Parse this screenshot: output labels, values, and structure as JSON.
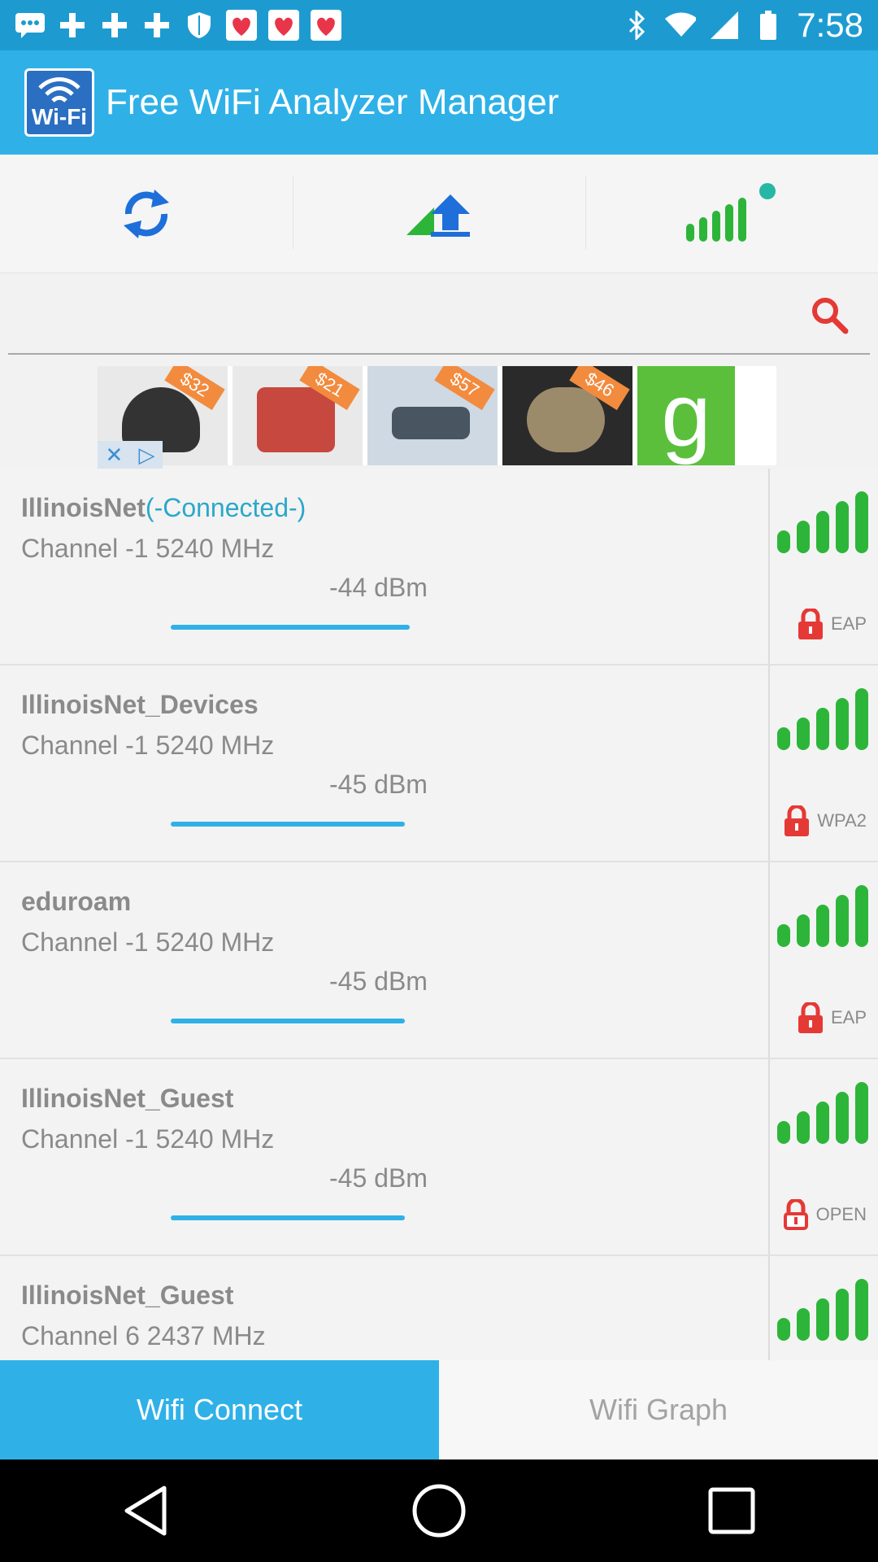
{
  "status_bar": {
    "time": "7:58",
    "icons": [
      "message-icon",
      "plus-icon",
      "plus-icon",
      "plus-icon",
      "shield-icon",
      "fastmeet-icon",
      "fastmeet-icon",
      "fastmeet-icon",
      "bluetooth-icon",
      "wifi-icon",
      "signal-icon",
      "battery-icon"
    ]
  },
  "app_bar": {
    "logo_text": "Wi-Fi",
    "title": "Free WiFi Analyzer Manager"
  },
  "toolbar": {
    "icons": [
      "refresh-icon",
      "upload-speed-icon",
      "signal-strength-icon"
    ],
    "accent_colors": {
      "blue": "#1e6fd9",
      "green": "#2db53a",
      "teal": "#27b7a5"
    }
  },
  "search": {
    "placeholder": "",
    "value": ""
  },
  "ad": {
    "prices": [
      "$32",
      "$21",
      "$57",
      "$46"
    ],
    "logo_glyph": "g"
  },
  "networks": [
    {
      "ssid": "IllinoisNet",
      "status": "(-Connected-)",
      "channel": "Channel -1 5240 MHz",
      "dbm": "-44 dBm",
      "security": "EAP",
      "locked": true,
      "strength": 0.59
    },
    {
      "ssid": "IllinoisNet_Devices",
      "status": "",
      "channel": "Channel -1 5240 MHz",
      "dbm": "-45 dBm",
      "security": "WPA2",
      "locked": true,
      "strength": 0.58
    },
    {
      "ssid": "eduroam",
      "status": "",
      "channel": "Channel -1 5240 MHz",
      "dbm": "-45 dBm",
      "security": "EAP",
      "locked": true,
      "strength": 0.58
    },
    {
      "ssid": "IllinoisNet_Guest",
      "status": "",
      "channel": "Channel -1 5240 MHz",
      "dbm": "-45 dBm",
      "security": "OPEN",
      "locked": false,
      "strength": 0.58
    },
    {
      "ssid": "IllinoisNet_Guest",
      "status": "",
      "channel": "Channel 6 2437 MHz",
      "dbm": "",
      "security": "",
      "locked": false,
      "strength": 0
    }
  ],
  "tabs": {
    "connect": "Wifi Connect",
    "graph": "Wifi Graph"
  },
  "nav": [
    "back-icon",
    "home-icon",
    "recents-icon"
  ]
}
